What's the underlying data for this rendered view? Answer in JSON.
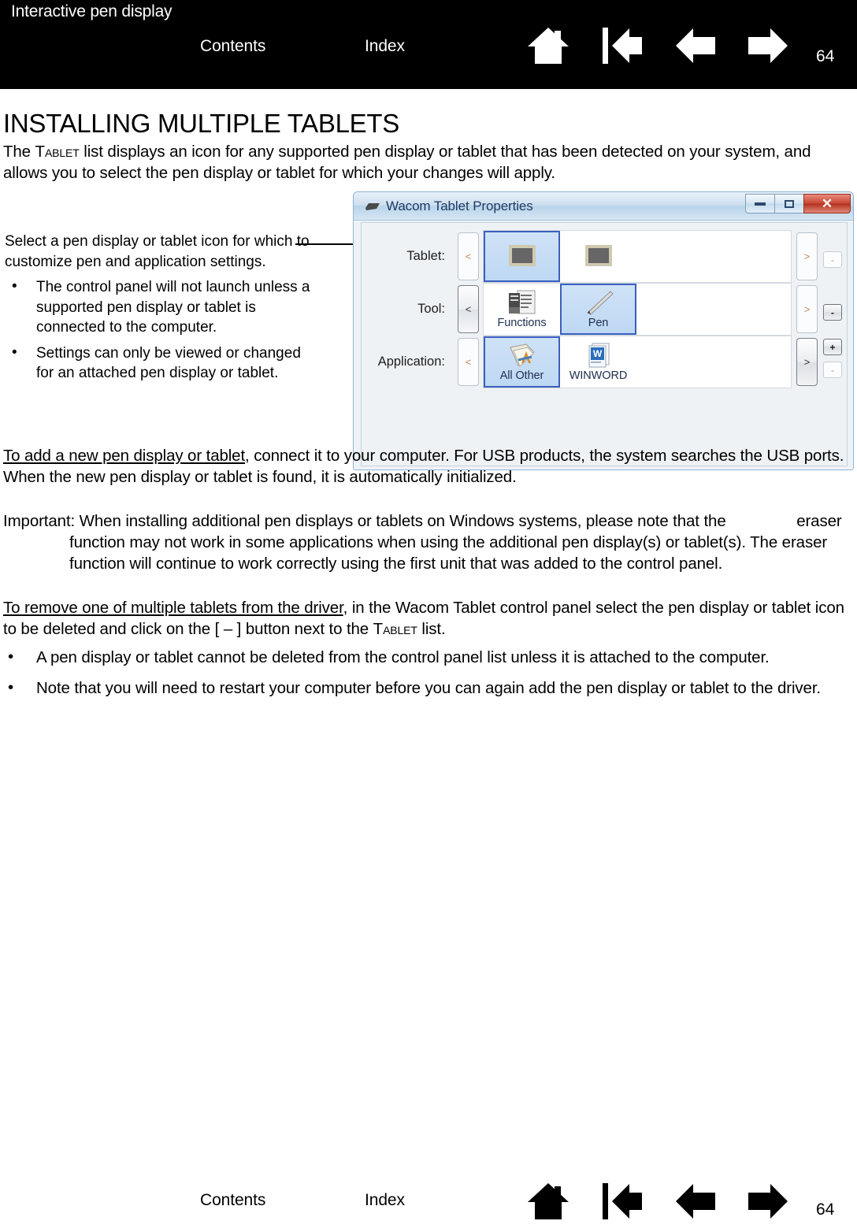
{
  "header": {
    "title": "Interactive pen display",
    "contents_label": "Contents",
    "index_label": "Index",
    "page_number": "64",
    "icons": [
      "home-icon",
      "first-page-icon",
      "previous-page-icon",
      "next-page-icon"
    ]
  },
  "main": {
    "heading": "INSTALLING MULTIPLE TABLETS",
    "intro": {
      "part1": "The ",
      "smallcaps": "Tablet",
      "part2": " list displays an icon for any supported pen display or tablet that has been detected on your system, and allows you to select the pen display or tablet for which your changes will apply."
    },
    "callout": {
      "lead": "Select a pen display or tablet icon for which to customize pen and application settings.",
      "bullet_char": "•",
      "items": [
        "The control panel will not launch unless a supported pen display or tablet is connected to the computer.",
        "Settings can only be viewed or changed for an attached pen display or tablet."
      ]
    },
    "paragraphs": {
      "add_link": "To add a new pen display or tablet",
      "add_rest": ", connect it to your computer.  For USB products, the system searches the USB ports.  When the new pen display or tablet is found, it is automatically initialized.",
      "important_label": "Important:",
      "important_text": " When installing additional pen displays or tablets on Windows systems, please note that the",
      "important_cont": "eraser function may not work in some applications when using the additional pen display(s) or tablet(s).  The eraser function will continue to work correctly using the first unit that was added to the control panel.",
      "remove_link": "To remove one of multiple tablets from the driver",
      "remove_mid": ", in the Wacom Tablet control panel select the pen display or tablet icon to be deleted and click on the [ – ] button next to the ",
      "remove_smallcaps": "Tablet",
      "remove_end": " list."
    },
    "bullets": {
      "bullet_char": "•",
      "items": [
        "A pen display or tablet cannot be deleted from the control panel list unless it is attached to the computer.",
        "Note that you will need to restart your computer before you can again add the pen display or tablet to the driver."
      ]
    }
  },
  "wacom_dialog": {
    "title": "Wacom Tablet Properties",
    "window_buttons": {
      "minimize": "minimize-icon",
      "maximize": "maximize-icon",
      "close": "✕"
    },
    "prev_arrow": "<",
    "next_arrow": ">",
    "minus_label": "-",
    "plus_label": "+",
    "rows": [
      {
        "label": "Tablet:",
        "cells": [
          {
            "label": "",
            "icon": "tablet-icon",
            "selected": true
          },
          {
            "label": "",
            "icon": "tablet-icon",
            "selected": false
          }
        ]
      },
      {
        "label": "Tool:",
        "cells": [
          {
            "label": "Functions",
            "icon": "functions-icon",
            "selected": false
          },
          {
            "label": "Pen",
            "icon": "pen-icon",
            "selected": true
          }
        ]
      },
      {
        "label": "Application:",
        "cells": [
          {
            "label": "All Other",
            "icon": "all-other-icon",
            "selected": true
          },
          {
            "label": "WINWORD",
            "icon": "winword-icon",
            "selected": false
          }
        ]
      }
    ]
  },
  "footer": {
    "contents_label": "Contents",
    "index_label": "Index",
    "page_number": "64"
  }
}
